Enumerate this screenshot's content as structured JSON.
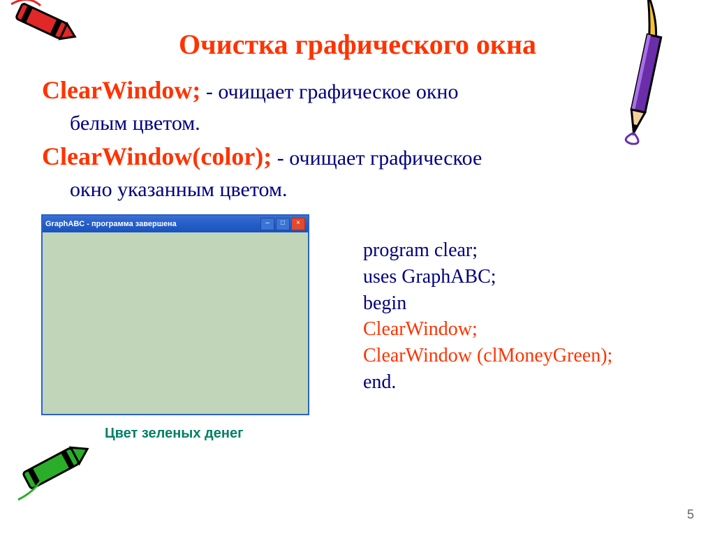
{
  "title": "Очистка графического окна",
  "para1_cmd": "ClearWindow;",
  "para1_desc_a": " - очищает графическое окно",
  "para1_desc_b": "белым цветом.",
  "para2_cmd": "ClearWindow(color);",
  "para2_desc_a": " - очищает графическое",
  "para2_desc_b": "окно указанным цветом.",
  "window_title": "GraphABC - программа завершена",
  "caption": "Цвет зеленых денег",
  "code": {
    "l1": "program clear;",
    "l2": "uses GraphABC;",
    "l3": "begin",
    "l4": "ClearWindow;",
    "l5": "ClearWindow (clMoneyGreen);",
    "l6": "end."
  },
  "page_number": "5"
}
